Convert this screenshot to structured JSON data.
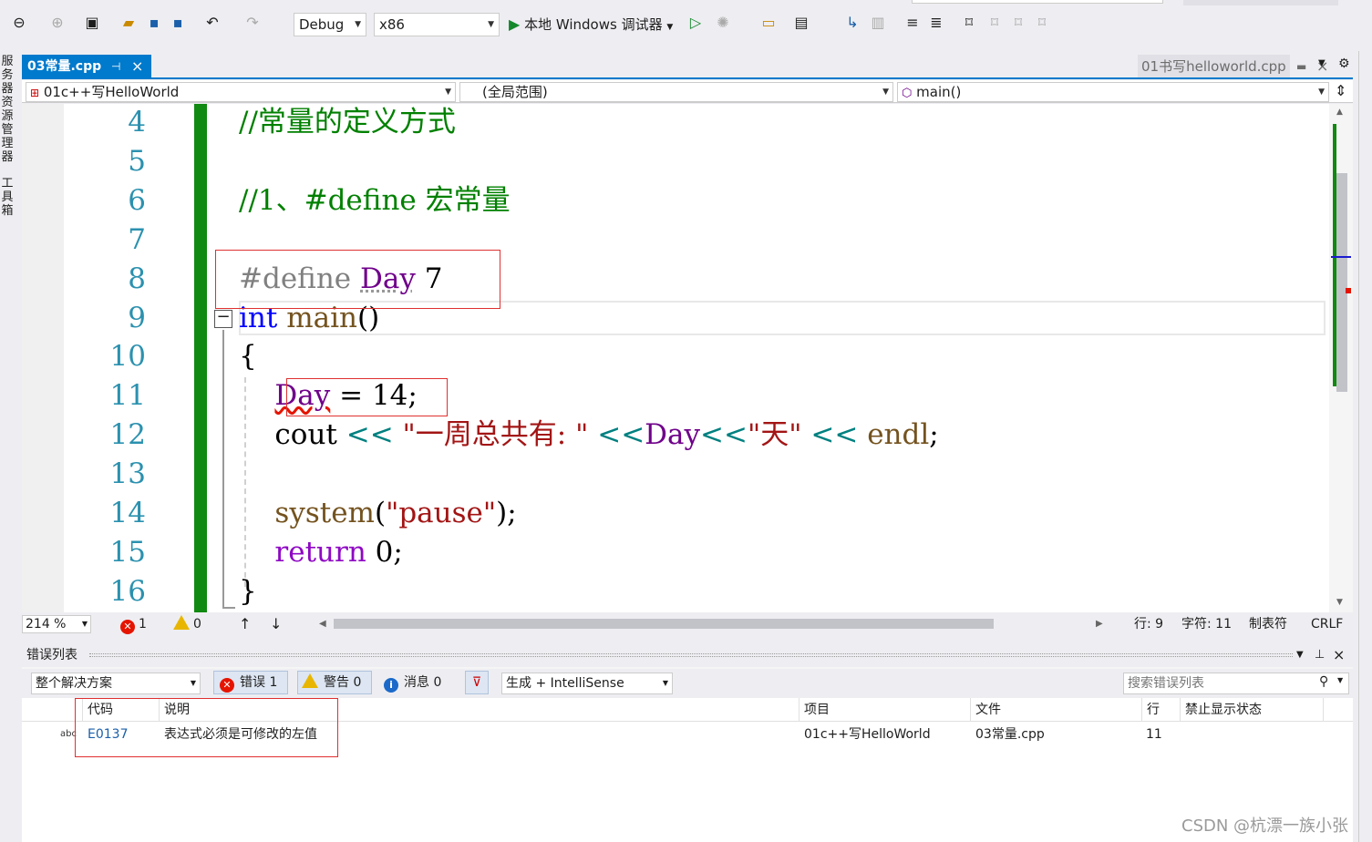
{
  "toolbar": {
    "config": "Debug",
    "platform": "x86",
    "run_label": "本地 Windows 调试器"
  },
  "left_panels": [
    "服务器资源管理器",
    "工具箱"
  ],
  "tabs": {
    "active": "03常量.cpp",
    "other": "01书写helloworld.cpp"
  },
  "nav": {
    "project": "01c++写HelloWorld",
    "scope": "(全局范围)",
    "member": "main()"
  },
  "editor": {
    "line_numbers": [
      "4",
      "5",
      "6",
      "7",
      "8",
      "9",
      "10",
      "11",
      "12",
      "13",
      "14",
      "15",
      "16"
    ]
  },
  "status": {
    "zoom": "214 %",
    "errors": "1",
    "warnings": "0",
    "row": "行: 9",
    "col": "字符: 11",
    "indent": "制表符",
    "eol": "CRLF"
  },
  "error_list": {
    "title": "错误列表",
    "scope": "整个解决方案",
    "errors_btn": "错误 1",
    "warnings_btn": "警告 0",
    "messages_btn": "消息 0",
    "build_filter": "生成 + IntelliSense",
    "search_placeholder": "搜索错误列表",
    "columns": [
      "代码",
      "说明",
      "项目",
      "文件",
      "行",
      "禁止显示状态"
    ],
    "rows": [
      {
        "code": "E0137",
        "desc": "表达式必须是可修改的左值",
        "project": "01c++写HelloWorld",
        "file": "03常量.cpp",
        "line": "11",
        "suppress": ""
      }
    ]
  },
  "watermark": "CSDN @杭漂一族小张",
  "colors": {
    "accent": "#007acc",
    "margin_green": "#108a10",
    "error_red": "#e51400"
  }
}
